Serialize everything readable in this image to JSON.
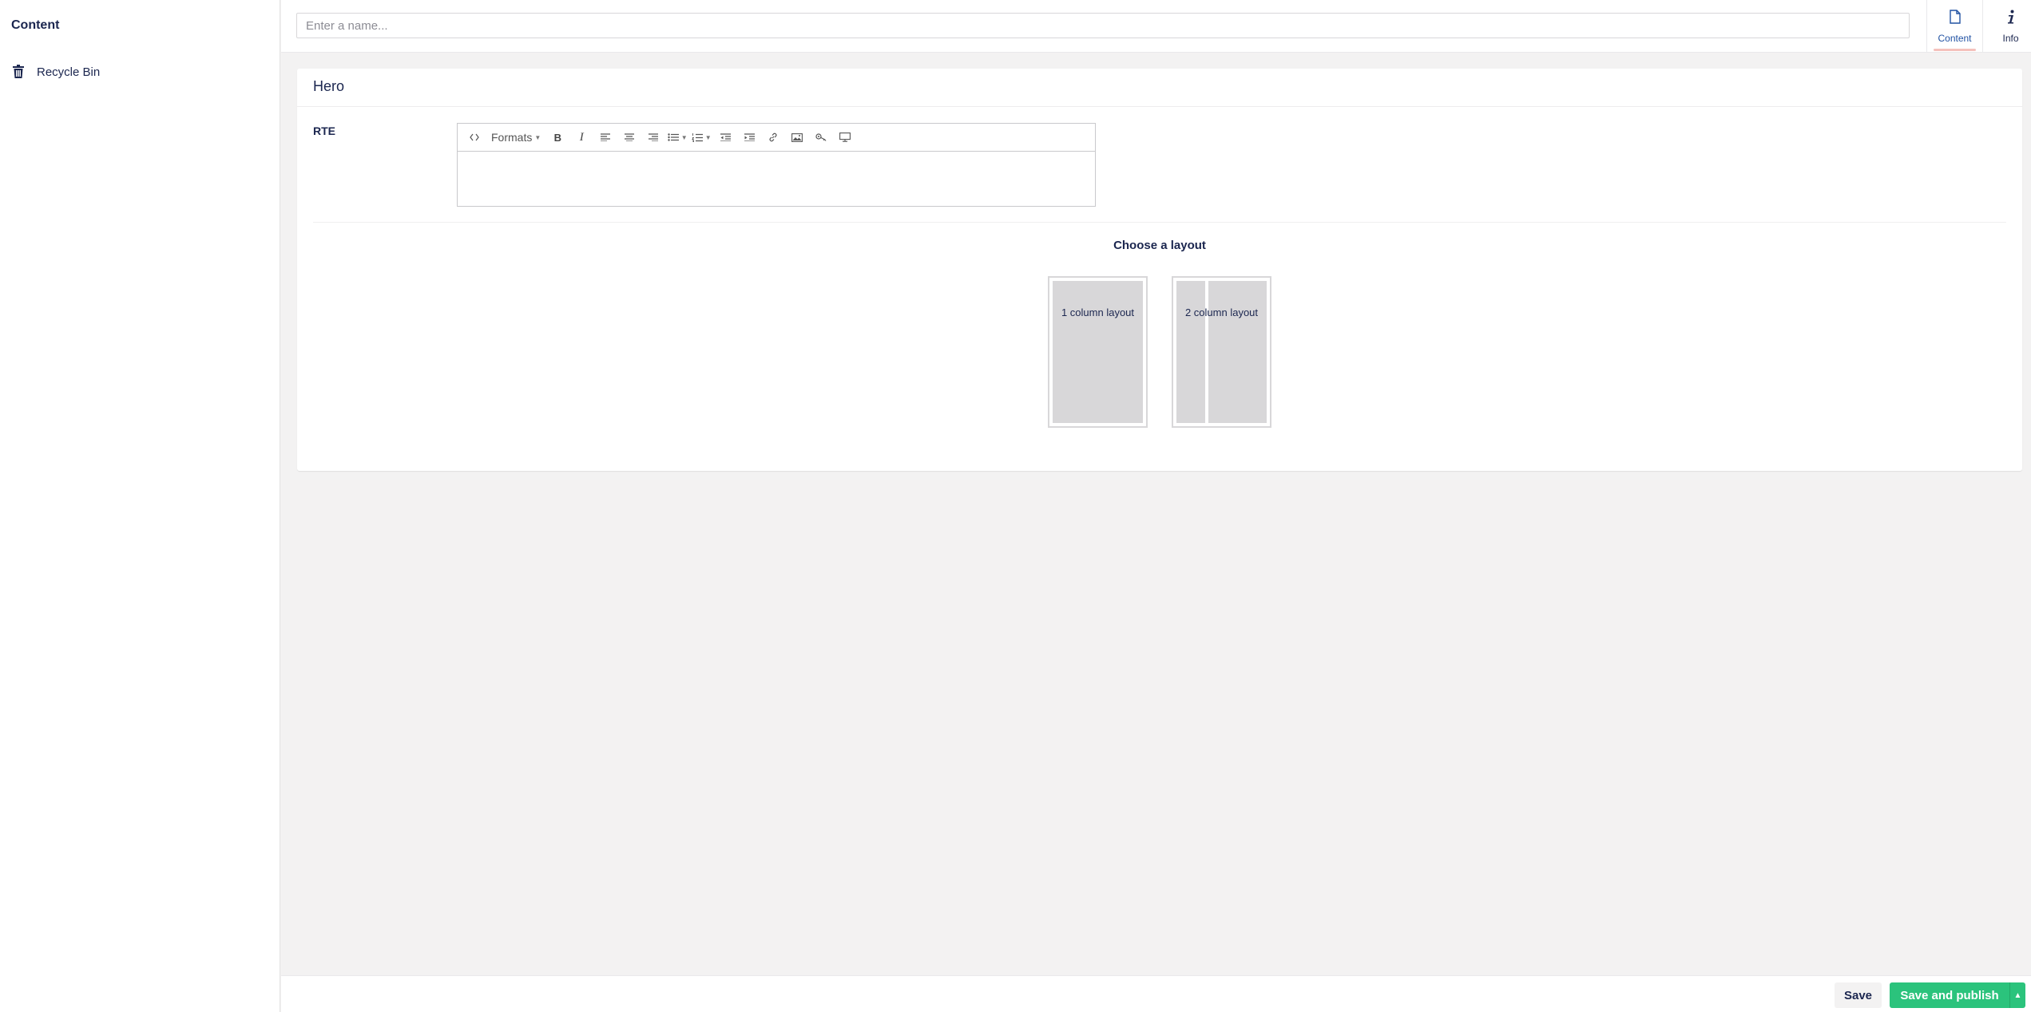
{
  "sidebar": {
    "title": "Content",
    "items": [
      {
        "label": "Recycle Bin",
        "icon": "trash-icon"
      }
    ]
  },
  "header": {
    "name_placeholder": "Enter a name...",
    "name_value": "",
    "apps": [
      {
        "label": "Content",
        "icon": "document-icon",
        "active": true
      },
      {
        "label": "Info",
        "icon": "info-icon",
        "active": false
      }
    ]
  },
  "panel": {
    "title": "Hero",
    "property_label": "RTE",
    "rte": {
      "formats_label": "Formats",
      "tools": [
        "code-icon",
        "formats-dropdown",
        "bold-icon",
        "italic-icon",
        "align-left-icon",
        "align-center-icon",
        "align-right-icon",
        "bullet-list-icon",
        "numbered-list-icon",
        "outdent-icon",
        "indent-icon",
        "link-icon",
        "image-icon",
        "macro-icon",
        "embed-icon"
      ],
      "content": ""
    },
    "layout_heading": "Choose a layout",
    "layouts": [
      {
        "label": "1 column layout"
      },
      {
        "label": "2 column layout"
      }
    ]
  },
  "footer": {
    "save_label": "Save",
    "publish_label": "Save and publish"
  },
  "colors": {
    "primary_text": "#1b264f",
    "publish_green": "#2bc37c",
    "active_tab_underline": "#f5c1bc",
    "background": "#f3f2f2"
  }
}
